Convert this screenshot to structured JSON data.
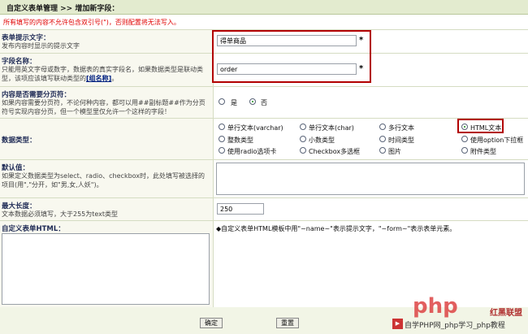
{
  "header": {
    "title": "自定义表单管理 >> 增加新字段："
  },
  "warning": "所有填写的内容不允许包含双引号(\")，否则配置将无法写入。",
  "fields": {
    "label_text": {
      "title": "表单提示文字：",
      "desc": "发布内容时显示的提示文字",
      "value": "得单商品",
      "required": "*"
    },
    "field_name": {
      "title": "字段名称：",
      "desc_a": "只能用英文字母或数字，数据表的真实字段名，如果数据类型是联动类型，该项应该填写联动类型的",
      "desc_link": "[组名称]",
      "desc_b": "。",
      "value": "order",
      "required": "*"
    },
    "paging": {
      "title": "内容是否需要分页符：",
      "desc": "如果内容需要分页符，不论何种内容，都可以用##副标题##作为分页符号实现内容分页，但一个模型里仅允许一个这样的字段！",
      "yes": "是",
      "no": "否",
      "selected": "no"
    },
    "data_type": {
      "title": "数据类型：",
      "options": [
        "单行文本(varchar)",
        "单行文本(char)",
        "多行文本",
        "HTML文本",
        "整数类型",
        "小数类型",
        "时间类型",
        "使用option下拉框",
        "使用radio选项卡",
        "Checkbox多选框",
        "图片",
        "附件类型"
      ],
      "selected": "HTML文本"
    },
    "default_value": {
      "title": "默认值：",
      "desc": "如果定义数据类型为select、radio、checkbox时，此处填写被选择的项目(用\",\"分开，如\"男,女,人妖\")。"
    },
    "max_length": {
      "title": "最大长度：",
      "desc": "文本数据必须填写，大于255为text类型",
      "value": "250"
    },
    "custom_html": {
      "title": "自定义表单HTML：",
      "hint": "◆自定义表单HTML模板中用\"~name~\"表示提示文字，\"~form~\"表示表单元素。"
    }
  },
  "buttons": {
    "ok": "确定",
    "reset": "重置"
  },
  "watermark": {
    "logo": "php",
    "brand": "红黑联盟",
    "site": "自学PHP网_php学习_php教程"
  },
  "colors": {
    "warning": "#e00000",
    "highlight": "#b20000"
  }
}
